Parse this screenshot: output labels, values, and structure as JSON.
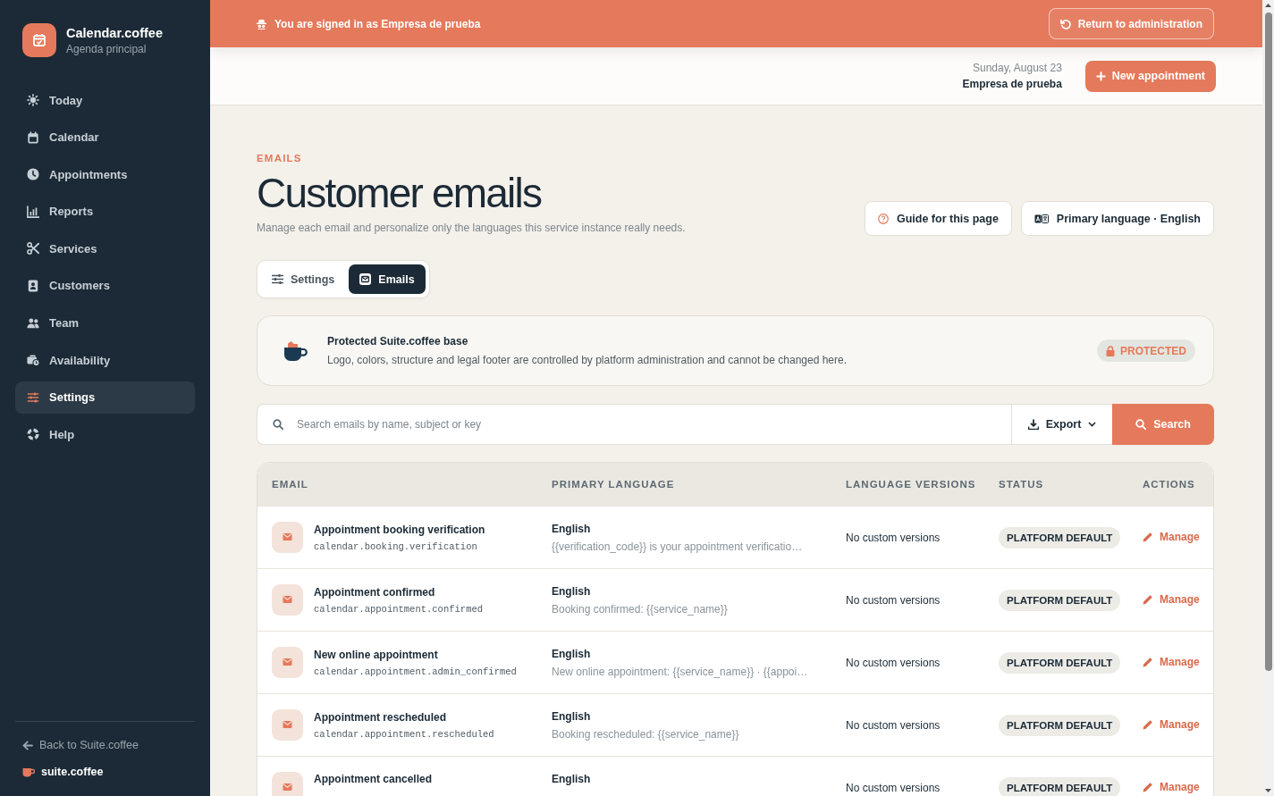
{
  "sidebar": {
    "brand": {
      "title": "Calendar.coffee",
      "subtitle": "Agenda principal"
    },
    "items": [
      {
        "label": "Today",
        "selected": false
      },
      {
        "label": "Calendar",
        "selected": false
      },
      {
        "label": "Appointments",
        "selected": false
      },
      {
        "label": "Reports",
        "selected": false
      },
      {
        "label": "Services",
        "selected": false
      },
      {
        "label": "Customers",
        "selected": false
      },
      {
        "label": "Team",
        "selected": false
      },
      {
        "label": "Availability",
        "selected": false
      },
      {
        "label": "Settings",
        "selected": true
      },
      {
        "label": "Help",
        "selected": false
      }
    ],
    "back_link": "Back to Suite.coffee",
    "footer_brand": "suite.coffee"
  },
  "banner": {
    "text": "You are signed in as Empresa de prueba",
    "button": "Return to administration"
  },
  "header": {
    "date": "Sunday, August 23",
    "company": "Empresa de prueba",
    "button": "New appointment"
  },
  "page": {
    "eyebrow": "EMAILS",
    "title": "Customer emails",
    "description": "Manage each email and personalize only the languages this service instance really needs.",
    "actions": [
      "Guide for this page",
      "Primary language · English"
    ]
  },
  "tabs": [
    {
      "label": "Settings",
      "selected": false
    },
    {
      "label": "Emails",
      "selected": true
    }
  ],
  "notice": {
    "title": "Protected Suite.coffee base",
    "text": "Logo, colors, structure and legal footer are controlled by platform administration and cannot be changed here.",
    "badge": "PROTECTED"
  },
  "search": {
    "placeholder": "Search emails by name, subject or key",
    "export": "Export",
    "button": "Search"
  },
  "table": {
    "columns": [
      "EMAIL",
      "PRIMARY LANGUAGE",
      "LANGUAGE VERSIONS",
      "STATUS",
      "ACTIONS"
    ],
    "rows": [
      {
        "name": "Appointment booking verification",
        "key": "calendar.booking.verification",
        "language": "English",
        "subject": "{{verification_code}} is your appointment verificatio…",
        "versions": "No custom versions",
        "status": "PLATFORM DEFAULT",
        "action": "Manage"
      },
      {
        "name": "Appointment confirmed",
        "key": "calendar.appointment.confirmed",
        "language": "English",
        "subject": "Booking confirmed: {{service_name}}",
        "versions": "No custom versions",
        "status": "PLATFORM DEFAULT",
        "action": "Manage"
      },
      {
        "name": "New online appointment",
        "key": "calendar.appointment.admin_confirmed",
        "language": "English",
        "subject": "New online appointment: {{service_name}} · {{appoi…",
        "versions": "No custom versions",
        "status": "PLATFORM DEFAULT",
        "action": "Manage"
      },
      {
        "name": "Appointment rescheduled",
        "key": "calendar.appointment.rescheduled",
        "language": "English",
        "subject": "Booking rescheduled: {{service_name}}",
        "versions": "No custom versions",
        "status": "PLATFORM DEFAULT",
        "action": "Manage"
      },
      {
        "name": "Appointment cancelled",
        "language": "English",
        "versions": "No custom versions",
        "status": "PLATFORM DEFAULT",
        "action": "Manage"
      }
    ]
  }
}
